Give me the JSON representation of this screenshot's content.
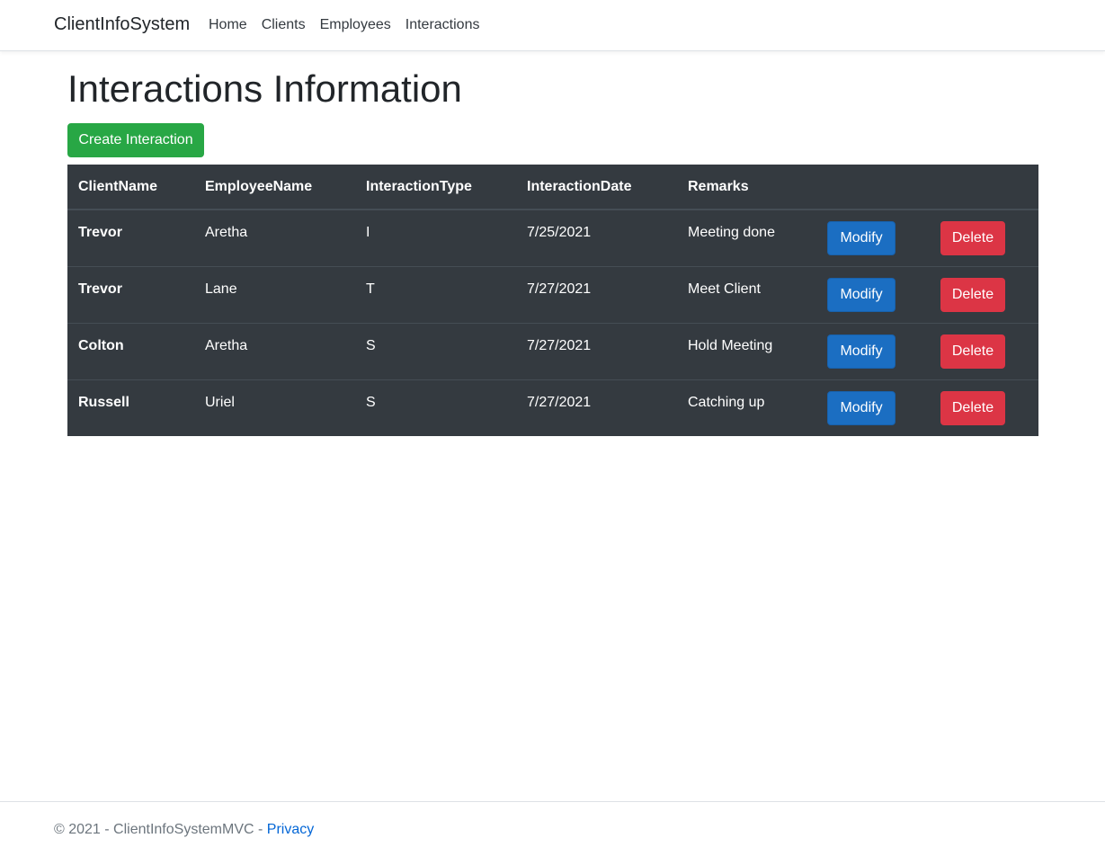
{
  "navbar": {
    "brand": "ClientInfoSystem",
    "links": [
      "Home",
      "Clients",
      "Employees",
      "Interactions"
    ]
  },
  "main": {
    "title": "Interactions Information",
    "create_label": "Create Interaction",
    "table": {
      "headers": [
        "ClientName",
        "EmployeeName",
        "InteractionType",
        "InteractionDate",
        "Remarks"
      ],
      "rows": [
        {
          "client": "Trevor",
          "employee": "Aretha",
          "type": "I",
          "date": "7/25/2021",
          "remarks": "Meeting done"
        },
        {
          "client": "Trevor",
          "employee": "Lane",
          "type": "T",
          "date": "7/27/2021",
          "remarks": "Meet Client"
        },
        {
          "client": "Colton",
          "employee": "Aretha",
          "type": "S",
          "date": "7/27/2021",
          "remarks": "Hold Meeting"
        },
        {
          "client": "Russell",
          "employee": "Uriel",
          "type": "S",
          "date": "7/27/2021",
          "remarks": "Catching up"
        }
      ],
      "modify_label": "Modify",
      "delete_label": "Delete"
    }
  },
  "footer": {
    "text": "© 2021 - ClientInfoSystemMVC - ",
    "privacy_label": "Privacy"
  },
  "colors": {
    "create_button": "#28a745",
    "modify_button": "#1b6ec2",
    "delete_button": "#dc3545",
    "table_background": "#343a40",
    "link": "#0366d6"
  }
}
